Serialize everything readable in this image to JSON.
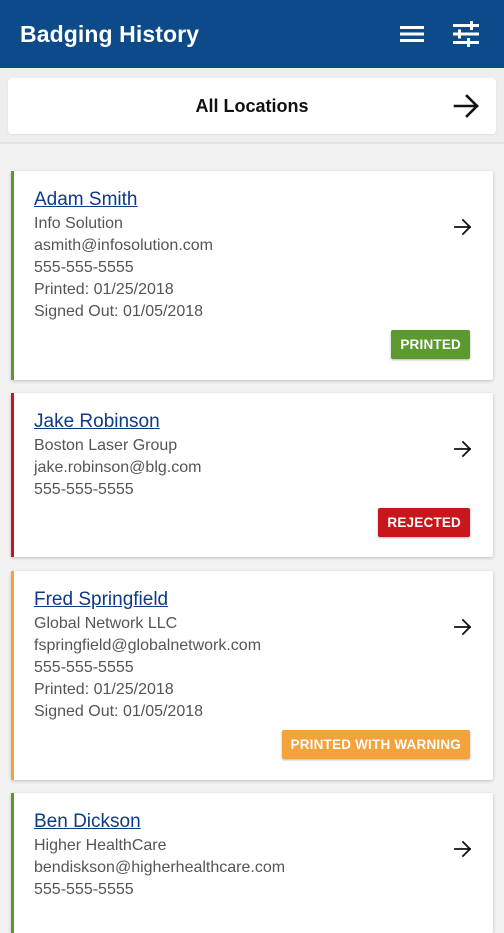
{
  "app": {
    "title": "Badging History"
  },
  "location": {
    "label": "All Locations"
  },
  "icons": {
    "menu": "hamburger-menu-icon",
    "filter": "sliders-filter-icon",
    "arrow": "arrow-right-icon"
  },
  "colors": {
    "primary": "#0d4a8a",
    "printed": "#5b9a2f",
    "rejected": "#c8161d",
    "warning": "#f4a23b"
  },
  "cards": [
    {
      "name": "Adam Smith",
      "company": "Info Solution",
      "email": "asmith@infosolution.com",
      "phone": "555-555-5555",
      "printed": "Printed: 01/25/2018",
      "signed_out": "Signed Out: 01/05/2018",
      "status": "PRINTED"
    },
    {
      "name": "Jake Robinson",
      "company": "Boston Laser Group",
      "email": "jake.robinson@blg.com",
      "phone": "555-555-5555",
      "status": "REJECTED"
    },
    {
      "name": "Fred Springfield",
      "company": "Global Network LLC",
      "email": "fspringfield@globalnetwork.com",
      "phone": "555-555-5555",
      "printed": "Printed: 01/25/2018",
      "signed_out": "Signed Out: 01/05/2018",
      "status": "PRINTED WITH WARNING"
    },
    {
      "name": "Ben Dickson",
      "company": "Higher HealthCare",
      "email": "bendiskson@higherhealthcare.com",
      "phone": "555-555-5555"
    }
  ]
}
